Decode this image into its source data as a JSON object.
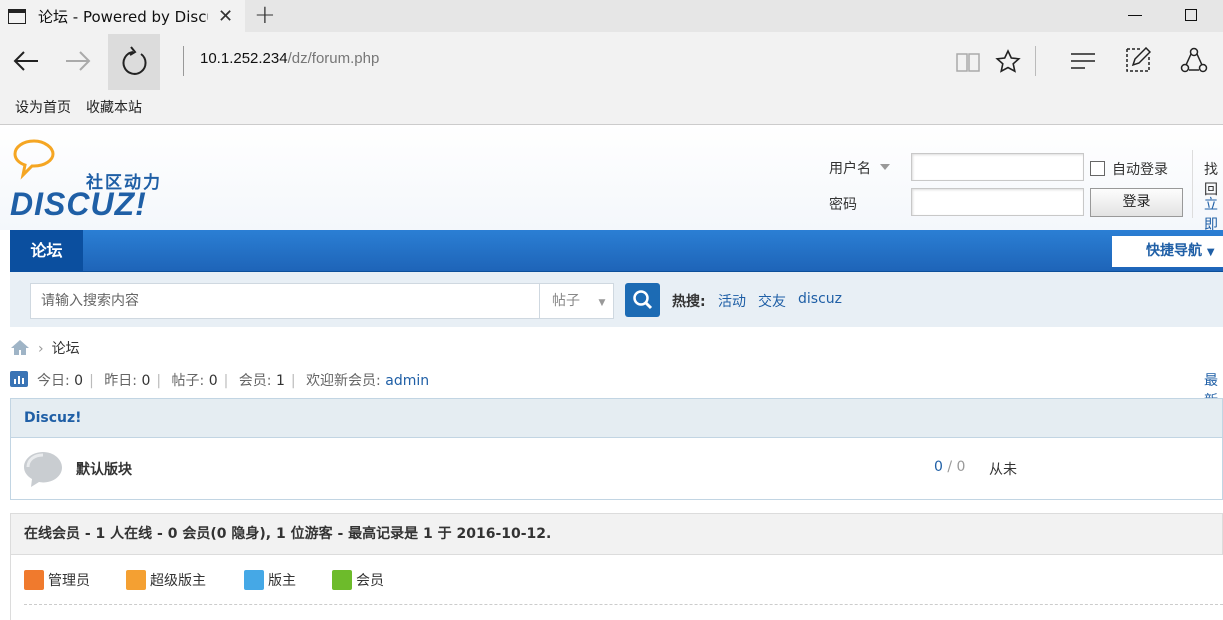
{
  "browser": {
    "tab_title": "论坛 - Powered by Discuz!",
    "address_host": "10.1.252.234",
    "address_path": "/dz/forum.php"
  },
  "favorites": [
    "设为首页",
    "收藏本站"
  ],
  "logo": {
    "slogan": "社区动力",
    "brand": "DISCUZ!"
  },
  "login": {
    "username_label": "用户名",
    "password_label": "密码",
    "auto_login": "自动登录",
    "login_button": "登录",
    "right_link_1": "找回",
    "right_link_2": "立即"
  },
  "nav": {
    "current": "论坛",
    "quick_nav": "快捷导航"
  },
  "search": {
    "placeholder": "请输入搜索内容",
    "type": "帖子",
    "hot_label": "热搜:",
    "hot_terms": [
      "活动",
      "交友",
      "discuz"
    ]
  },
  "breadcrumb": {
    "current": "论坛"
  },
  "stats": {
    "today_label": "今日:",
    "today": "0",
    "yesterday_label": "昨日:",
    "yesterday": "0",
    "posts_label": "帖子:",
    "posts": "0",
    "members_label": "会员:",
    "members": "1",
    "welcome_label": "欢迎新会员:",
    "newest_member": "admin",
    "right_text": "最新"
  },
  "category": {
    "name": "Discuz!"
  },
  "forum": {
    "name": "默认版块",
    "threads": "0",
    "posts": "0",
    "last_post": "从未"
  },
  "online": {
    "summary": "在线会员 - 1 人在线 - 0 会员(0 隐身), 1 位游客 - 最高记录是 1 于 2016-10-12."
  },
  "legend": [
    {
      "label": "管理员",
      "color": "#f07a2d"
    },
    {
      "label": "超级版主",
      "color": "#f4a032"
    },
    {
      "label": "版主",
      "color": "#45a8e6"
    },
    {
      "label": "会员",
      "color": "#6dbb2b"
    }
  ]
}
